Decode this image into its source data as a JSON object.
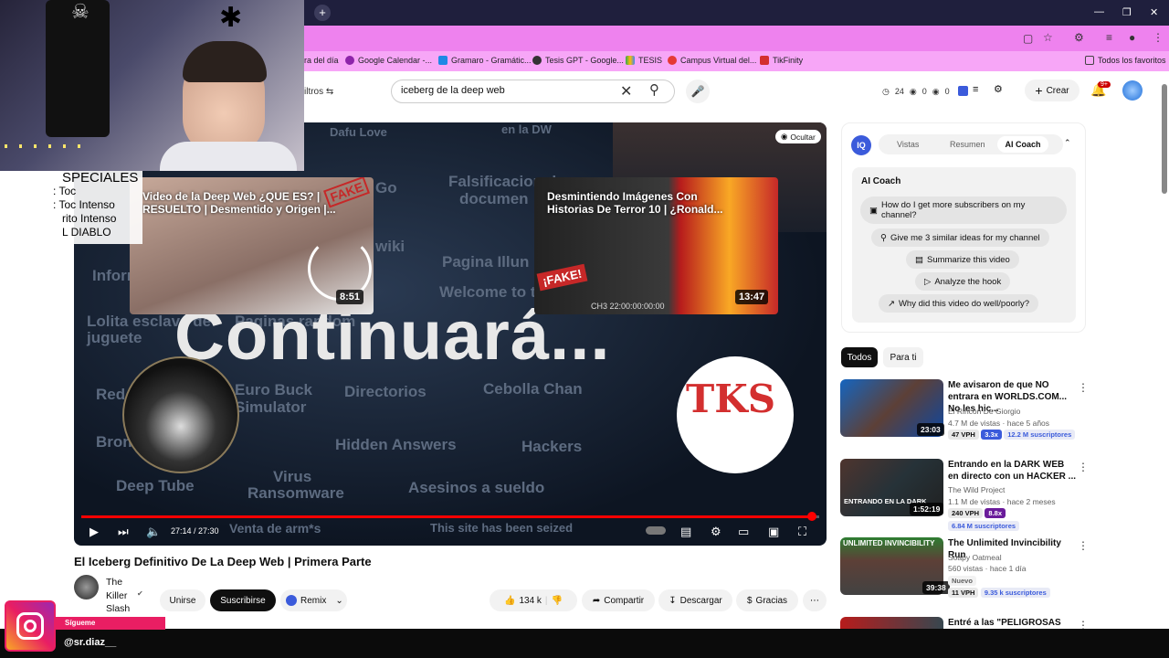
{
  "browser": {
    "new_tab_glyph": "+",
    "bookmarks": [
      {
        "label": "ra del día"
      },
      {
        "label": "Google Calendar -..."
      },
      {
        "label": "Gramaro - Gramátic..."
      },
      {
        "label": "Tesis GPT - Google..."
      },
      {
        "label": "TESIS"
      },
      {
        "label": "Campus Virtual del..."
      },
      {
        "label": "TikFinity"
      }
    ],
    "all_bookmarks": "Todos los favoritos"
  },
  "header": {
    "filters_label": "iltros",
    "search_value": "iceberg de la deep web",
    "stats": {
      "views": "24",
      "a": "0",
      "b": "0"
    },
    "create_label": "Crear",
    "notif_count": "9+"
  },
  "video": {
    "hide_label": "Ocultar",
    "big_text": "Continuará...",
    "bg_words": [
      "Dafu Love",
      "Falsificacion de",
      "documen",
      "Pagina Illun",
      "Welcome to the game",
      "Informa",
      "Lolita esclava de",
      "juguete",
      "Euro Buck",
      "Simulator",
      "Directorios",
      "Cebolla Chan",
      "Hidden Answers",
      "Hackers",
      "Red",
      "Bron",
      "Deep Tube",
      "Virus",
      "Ransomware",
      "Asesinos a sueldo",
      "Venta de arm*s",
      "This site has been seized",
      "Go",
      "wiki",
      "en la DW",
      "Paginas random"
    ],
    "endcards": [
      {
        "title": "Video de la Deep Web ¿QUE ES? | RESUELTO | Desmentido y Origen |...",
        "duration": "8:51"
      },
      {
        "title": "Desmintiendo Imágenes Con Historias De Terror 10 | ¿Ronald...",
        "duration": "13:47"
      }
    ],
    "fake_stamp": "¡FAKE!",
    "fake_stamp_top": "FAKE",
    "timestamp_overlay": "CH3 22:00:00:00:00",
    "tks_logo": "TKS",
    "time": "27:14 / 27:30",
    "progress": 0.99
  },
  "webcam_overlay": {
    "lines": [
      "SPECIALES",
      ": Toc",
      ": Toc Intenso",
      "rito Intenso",
      "L DIABLO"
    ]
  },
  "below": {
    "title": "El Iceberg Definitivo De La Deep Web | Primera Parte",
    "channel": "The Killer Slash",
    "join": "Unirse",
    "subscribe": "Suscribirse",
    "remix": "Remix",
    "likes": "134 k",
    "share": "Compartir",
    "download": "Descargar",
    "thanks": "Gracias"
  },
  "ai_panel": {
    "tabs": [
      "Vistas",
      "Resumen",
      "AI Coach"
    ],
    "heading": "AI Coach",
    "questions": [
      "How do I get more subscribers on my channel?",
      "Give me 3 similar ideas for my channel",
      "Summarize this video",
      "Analyze the hook",
      "Why did this video do well/poorly?"
    ]
  },
  "chips": [
    "Todos",
    "Para ti"
  ],
  "recommendations": [
    {
      "title": "Me avisaron de que NO entrara en WORLDS.COM... No les hic...",
      "channel": "El Rincón De Giorgio",
      "meta": "4.7 M de vistas · hace 5 años",
      "vph": "47 VPH",
      "mult": "3.3x",
      "subs": "12.2 M suscriptores",
      "duration": "23:03"
    },
    {
      "title": "Entrando en la DARK WEB en directo con un HACKER ...",
      "channel": "The Wild Project",
      "meta": "1.1 M de vistas · hace 2 meses",
      "vph": "240 VPH",
      "mult": "8.8x",
      "subs": "6.84 M suscriptores",
      "duration": "1:52:19",
      "thumb_text": "ENTRANDO EN LA DARK"
    },
    {
      "title": "The Unlimited Invincibility Run",
      "channel": "Soapy Oatmeal",
      "meta": "560 vistas · hace 1 día",
      "tag": "Nuevo",
      "vph": "11 VPH",
      "subs": "9.35 k suscriptores",
      "duration": "39:38",
      "thumb_text": "UNLIMITED INVINCIBILITY"
    },
    {
      "title": "Entré a las \"PELIGROSAS"
    }
  ],
  "overlay": {
    "sigueme": "Sígueme",
    "handle": "@sr.diaz__"
  },
  "colors": {
    "accent_red": "#ff0000",
    "chrome_pink": "#ee82ee",
    "ai_blue": "#3b5bdb"
  }
}
